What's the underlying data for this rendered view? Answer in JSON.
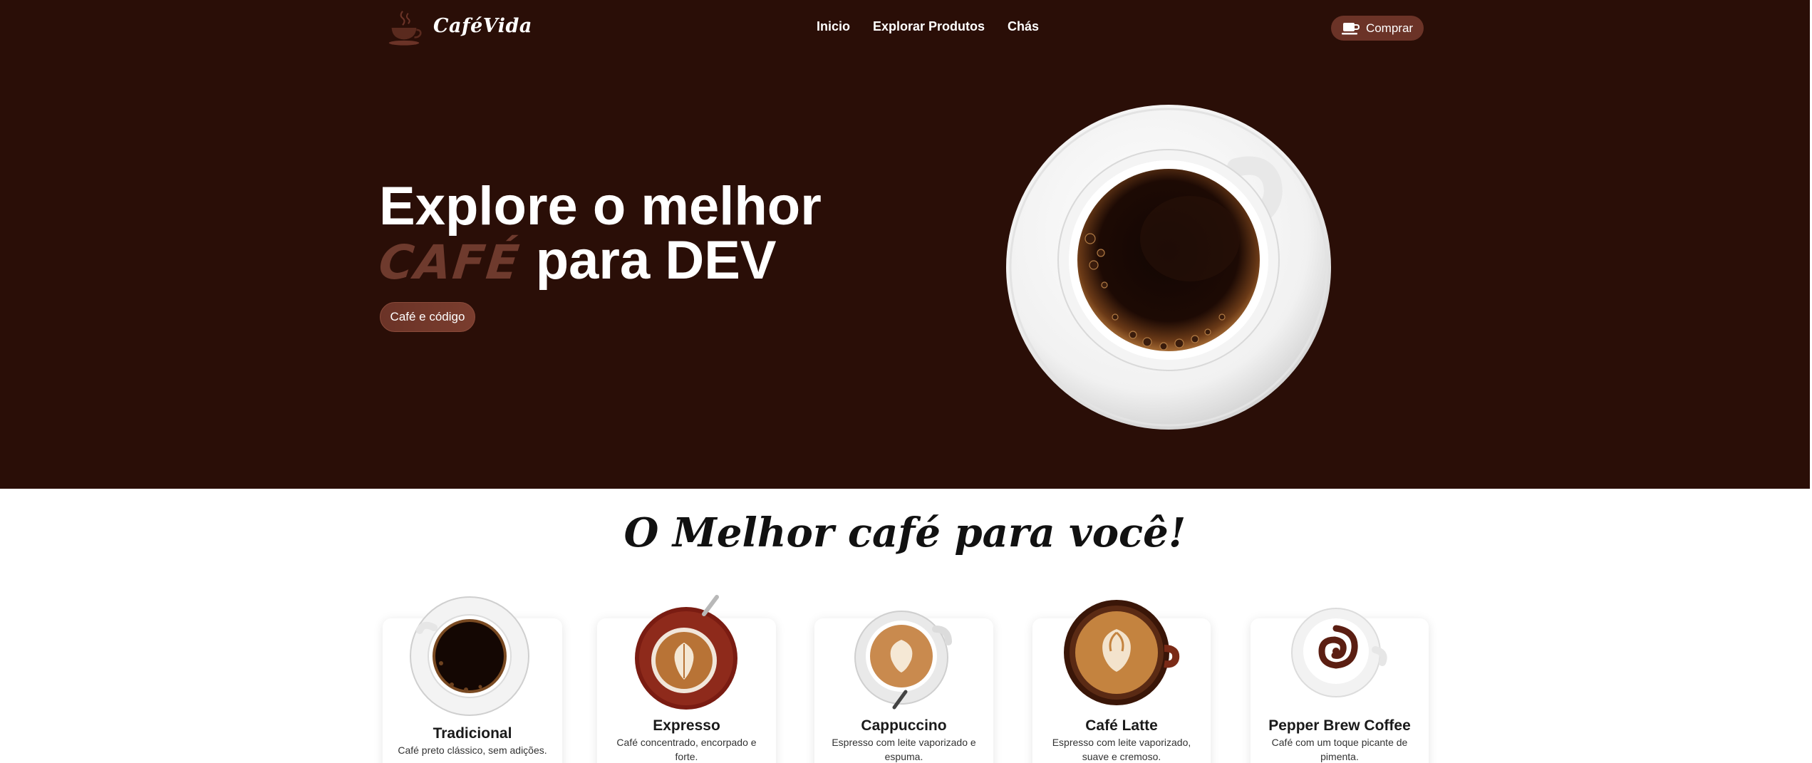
{
  "colors": {
    "hero_bg": "#2a0e07",
    "accent": "#6b3327",
    "accent_text": "#6e3a2d",
    "page_bg": "#ffffff"
  },
  "header": {
    "logo_text": "CaféVida",
    "logo_icon": "coffee-cup-icon",
    "nav": [
      "Inicio",
      "Explorar Produtos",
      "Chás"
    ],
    "buy_label": "Comprar",
    "buy_icon": "coffee-cup-icon"
  },
  "hero": {
    "title_line1": "Explore o melhor",
    "title_accent": "CAFÉ",
    "title_line2_rest": "para DEV",
    "button_label": "Café e código",
    "image": "coffee-cup-top-view"
  },
  "products": {
    "title": "O Melhor café para você!",
    "items": [
      {
        "name": "Tradicional",
        "desc": "Café preto clássico, sem adições."
      },
      {
        "name": "Expresso",
        "desc": "Café concentrado, encorpado e forte."
      },
      {
        "name": "Cappuccino",
        "desc": "Espresso com leite vaporizado e espuma."
      },
      {
        "name": "Café Latte",
        "desc": "Espresso com leite vaporizado, suave e cremoso."
      },
      {
        "name": "Pepper Brew Coffee",
        "desc": "Café com um toque picante de pimenta."
      }
    ]
  }
}
